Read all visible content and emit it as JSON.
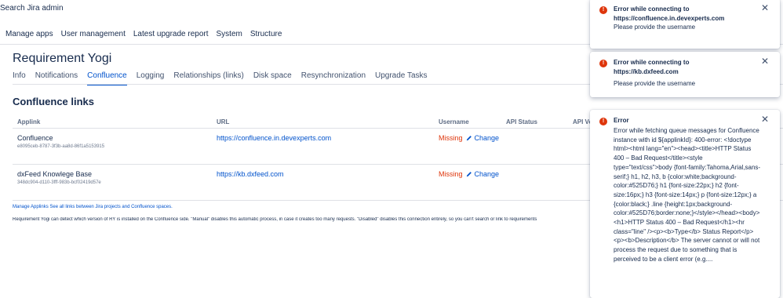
{
  "header": {
    "search_text": "Search Jira admin"
  },
  "admin_nav": [
    "Manage apps",
    "User management",
    "Latest upgrade report",
    "System",
    "Structure"
  ],
  "page": {
    "title": "Requirement Yogi"
  },
  "tabs": [
    "Info",
    "Notifications",
    "Confluence",
    "Logging",
    "Relationships (links)",
    "Disk space",
    "Resynchronization",
    "Upgrade Tasks"
  ],
  "active_tab": "Confluence",
  "section": {
    "title": "Confluence links"
  },
  "table": {
    "columns": [
      "Applink",
      "URL",
      "Username",
      "API Status",
      "API Ve"
    ],
    "rows": [
      {
        "name": "Confluence",
        "id": "e8095ceb-8787-3f3b-aa8d-86f1a5153915",
        "url": "https://confluence.in.devexperts.com",
        "username_status": "Missing",
        "change_label": "Change"
      },
      {
        "name": "dxFeed Knowlege Base",
        "id": "348dc904-d110-3fff-983b-bcf02419d57e",
        "url": "https://kb.dxfeed.com",
        "username_status": "Missing",
        "change_label": "Change"
      }
    ]
  },
  "footer": {
    "manage_applinks": "Manage Applinks",
    "see_all_links": "See all links between Jira projects and Confluence spaces.",
    "description": "Requirement Yogi can detect which version of RY is installed on the Confluence side. \"Manual\" disables this automatic process, in case it creates too many requests. \"Disabled\" disables this connection entirely, so you can't search or link to requirements"
  },
  "flags": [
    {
      "title": "Error while connecting to https://confluence.in.devexperts.com",
      "body": "Please provide the username"
    },
    {
      "title": "Error while connecting to https://kb.dxfeed.com",
      "body": "Please provide the username"
    },
    {
      "title": "Error",
      "body": "Error while fetching queue messages for Confluence instance with id ${applinkId}: 400-error: <!doctype html><html lang=\"en\"><head><title>HTTP Status 400 – Bad Request</title><style type=\"text/css\">body {font-family:Tahoma,Arial,sans-serif;} h1, h2, h3, b {color:white;background-color:#525D76;} h1 {font-size:22px;} h2 {font-size:16px;} h3 {font-size:14px;} p {font-size:12px;} a {color:black;} .line {height:1px;background-color:#525D76;border:none;}</style></head><body><h1>HTTP Status 400 – Bad Request</h1><hr class=\"line\" /><p><b>Type</b> Status Report</p><p><b>Description</b> The server cannot or will not process the request due to something that is perceived to be a client error (e.g...."
    }
  ],
  "flag_close_symbol": "✕",
  "flag_icon_symbol": "!",
  "colors": {
    "link": "#0052cc",
    "error": "#de350b",
    "text": "#172b4d"
  }
}
